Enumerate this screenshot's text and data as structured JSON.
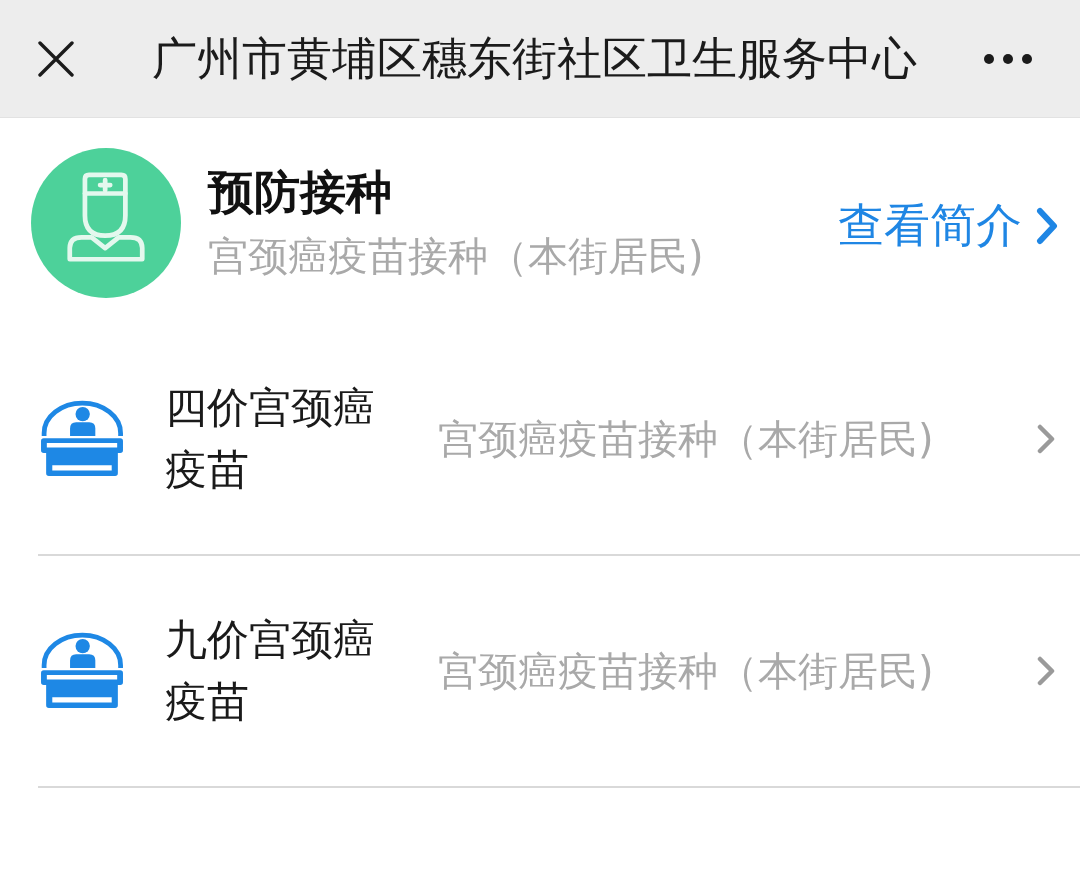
{
  "header": {
    "title": "广州市黄埔区穗东街社区卫生服务中心"
  },
  "service": {
    "title": "预防接种",
    "subtitle": "宫颈癌疫苗接种（本街居民)",
    "link": "查看简介"
  },
  "items": [
    {
      "name": "四价宫颈癌疫苗",
      "description": "宫颈癌疫苗接种（本街居民)"
    },
    {
      "name": "九价宫颈癌疫苗",
      "description": "宫颈癌疫苗接种（本街居民)"
    }
  ]
}
